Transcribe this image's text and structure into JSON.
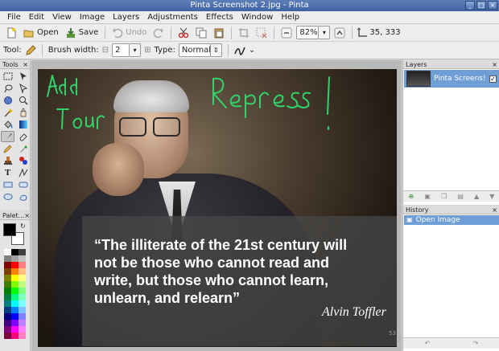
{
  "window": {
    "title": "Pinta Screenshot 2.jpg - Pinta",
    "min_glyph": "_",
    "max_glyph": "□",
    "close_glyph": "×"
  },
  "menu": [
    "File",
    "Edit",
    "View",
    "Image",
    "Layers",
    "Adjustments",
    "Effects",
    "Window",
    "Help"
  ],
  "toolbar": {
    "open_label": "Open",
    "save_label": "Save",
    "undo_label": "Undo",
    "zoom_value": "82%",
    "cursor_position": "35, 333"
  },
  "toolbar2": {
    "tool_label": "Tool:",
    "brush_width_label": "Brush width:",
    "brush_width_value": "2",
    "type_label": "Type:",
    "type_value": "Normal"
  },
  "tools_panel": {
    "title": "Tools",
    "close_glyph": "×"
  },
  "palette_panel": {
    "title": "Palet...",
    "close_glyph": "×",
    "primary_color": "#000000",
    "secondary_color": "#ffffff"
  },
  "canvas": {
    "quote_lines": [
      "“The illiterate of the 21st century will",
      "not be those who cannot read and",
      "write, but those who cannot learn,",
      "unlearn, and relearn”"
    ],
    "author": "Alvin Toffler",
    "corner_number": "53",
    "scribble_color": "#2fd36a"
  },
  "layers_panel": {
    "title": "Layers",
    "close_glyph": "×",
    "layer_name": "Pinta Screens!",
    "layer_visible_glyph": "✓"
  },
  "history_panel": {
    "title": "History",
    "close_glyph": "×",
    "item": "Open Image"
  },
  "palette_colors": [
    "#ffffff",
    "#000000",
    "#404040",
    "#808080",
    "#a0a0a0",
    "#c0c0c0",
    "#7f0000",
    "#ff0000",
    "#ff7f7f",
    "#7f3f00",
    "#ff7f00",
    "#ffbf7f",
    "#7f7f00",
    "#ffff00",
    "#ffff7f",
    "#3f7f00",
    "#7fff00",
    "#bfff7f",
    "#007f00",
    "#00ff00",
    "#7fff7f",
    "#007f3f",
    "#00ff7f",
    "#7fffbf",
    "#007f7f",
    "#00ffff",
    "#7fffff",
    "#003f7f",
    "#007fff",
    "#7fbfff",
    "#00007f",
    "#0000ff",
    "#7f7fff",
    "#3f007f",
    "#7f00ff",
    "#bf7fff",
    "#7f007f",
    "#ff00ff",
    "#ff7fff",
    "#7f003f",
    "#ff007f",
    "#ff7fbf"
  ]
}
